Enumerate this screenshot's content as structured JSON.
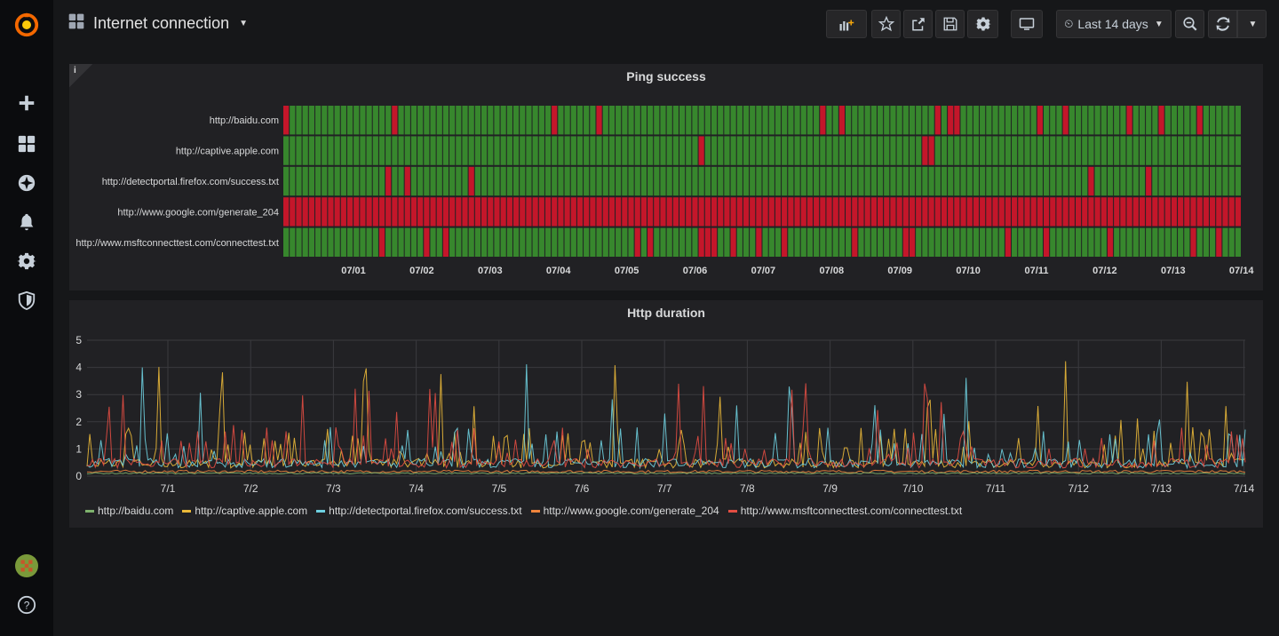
{
  "dashboard": {
    "title": "Internet connection"
  },
  "sidebar": {
    "items": [
      {
        "icon": "grafana-logo"
      },
      {
        "icon": "plus-icon"
      },
      {
        "icon": "dashboards-icon"
      },
      {
        "icon": "explore-icon"
      },
      {
        "icon": "alerting-icon"
      },
      {
        "icon": "configuration-icon"
      },
      {
        "icon": "server-admin-icon"
      },
      {
        "icon": "avatar"
      },
      {
        "icon": "help-icon"
      }
    ]
  },
  "navbar": {
    "time_range": "Last 14 days",
    "buttons": [
      "add-panel-icon",
      "star-icon",
      "share-icon",
      "save-icon",
      "settings-icon",
      "tv-mode-icon",
      "zoom-out-icon",
      "refresh-icon"
    ]
  },
  "colors": {
    "ok": "#37872d",
    "fail": "#c4162a",
    "series": [
      "#7eb26d",
      "#eab839",
      "#6ed0e0",
      "#ef843c",
      "#e24d42"
    ]
  },
  "panels": {
    "ping": {
      "title": "Ping success",
      "info": "i"
    },
    "http": {
      "title": "Http duration"
    }
  },
  "chart_data": [
    {
      "type": "heatmap",
      "title": "Ping success",
      "rows": [
        "http://baidu.com",
        "http://captive.apple.com",
        "http://detectportal.firefox.com/success.txt",
        "http://www.google.com/generate_204",
        "http://www.msftconnecttest.com/connecttest.txt"
      ],
      "x_ticks": [
        "07/01",
        "07/02",
        "07/03",
        "07/04",
        "07/05",
        "07/06",
        "07/07",
        "07/08",
        "07/09",
        "07/10",
        "07/11",
        "07/12",
        "07/13",
        "07/14"
      ],
      "values": [
        "ok",
        "fail"
      ],
      "google_all_fail": true
    },
    {
      "type": "line",
      "title": "Http duration",
      "y_ticks": [
        "0",
        "1",
        "2",
        "3",
        "4",
        "5"
      ],
      "ylim": [
        0,
        5
      ],
      "x_ticks": [
        "7/1",
        "7/2",
        "7/3",
        "7/4",
        "7/5",
        "7/6",
        "7/7",
        "7/8",
        "7/9",
        "7/10",
        "7/11",
        "7/12",
        "7/13",
        "7/14"
      ],
      "grid": true,
      "legend_position": "bottom",
      "series": [
        {
          "name": "http://baidu.com",
          "color": "#7eb26d"
        },
        {
          "name": "http://captive.apple.com",
          "color": "#eab839"
        },
        {
          "name": "http://detectportal.firefox.com/success.txt",
          "color": "#6ed0e0"
        },
        {
          "name": "http://www.google.com/generate_204",
          "color": "#ef843c"
        },
        {
          "name": "http://www.msftconnecttest.com/connecttest.txt",
          "color": "#e24d42"
        }
      ]
    }
  ]
}
